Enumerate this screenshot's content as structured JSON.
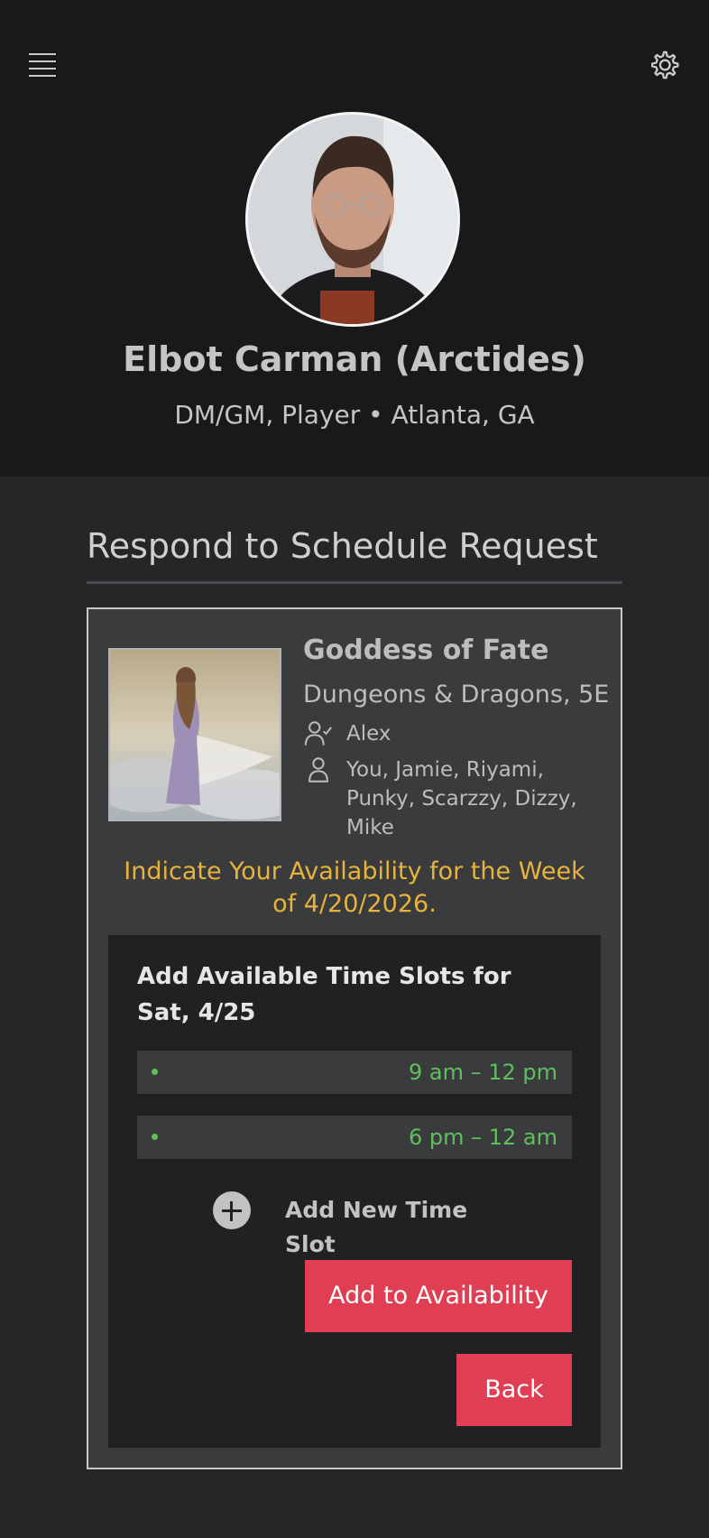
{
  "profile": {
    "name": "Elbot Carman (Arctides)",
    "meta": "DM/GM, Player • Atlanta, GA"
  },
  "icons": {
    "menu": "hamburger-menu-icon",
    "settings": "gear-icon",
    "gm": "user-check-icon",
    "players": "user-icon",
    "add": "plus-circle-icon"
  },
  "section": {
    "title": "Respond to Schedule Request"
  },
  "game": {
    "title": "Goddess of Fate",
    "system": "Dungeons & Dragons, 5E",
    "gm": "Alex",
    "players": "You, Jamie, Riyami, Punky, Scarzzy, Dizzy, Mike"
  },
  "notice": "Indicate Your Availability for the Week of 4/20/2026.",
  "slots": {
    "heading": "Add Available Time Slots for Sat, 4/25",
    "items": [
      {
        "time": "9 am – 12 pm"
      },
      {
        "time": "6 pm – 12 am"
      }
    ],
    "add_label": "Add New Time Slot"
  },
  "buttons": {
    "add_availability": "Add to Availability",
    "back": "Back"
  },
  "colors": {
    "accent": "#e03e52",
    "notice": "#e8b33d",
    "slot_time": "#5fbf5e"
  }
}
